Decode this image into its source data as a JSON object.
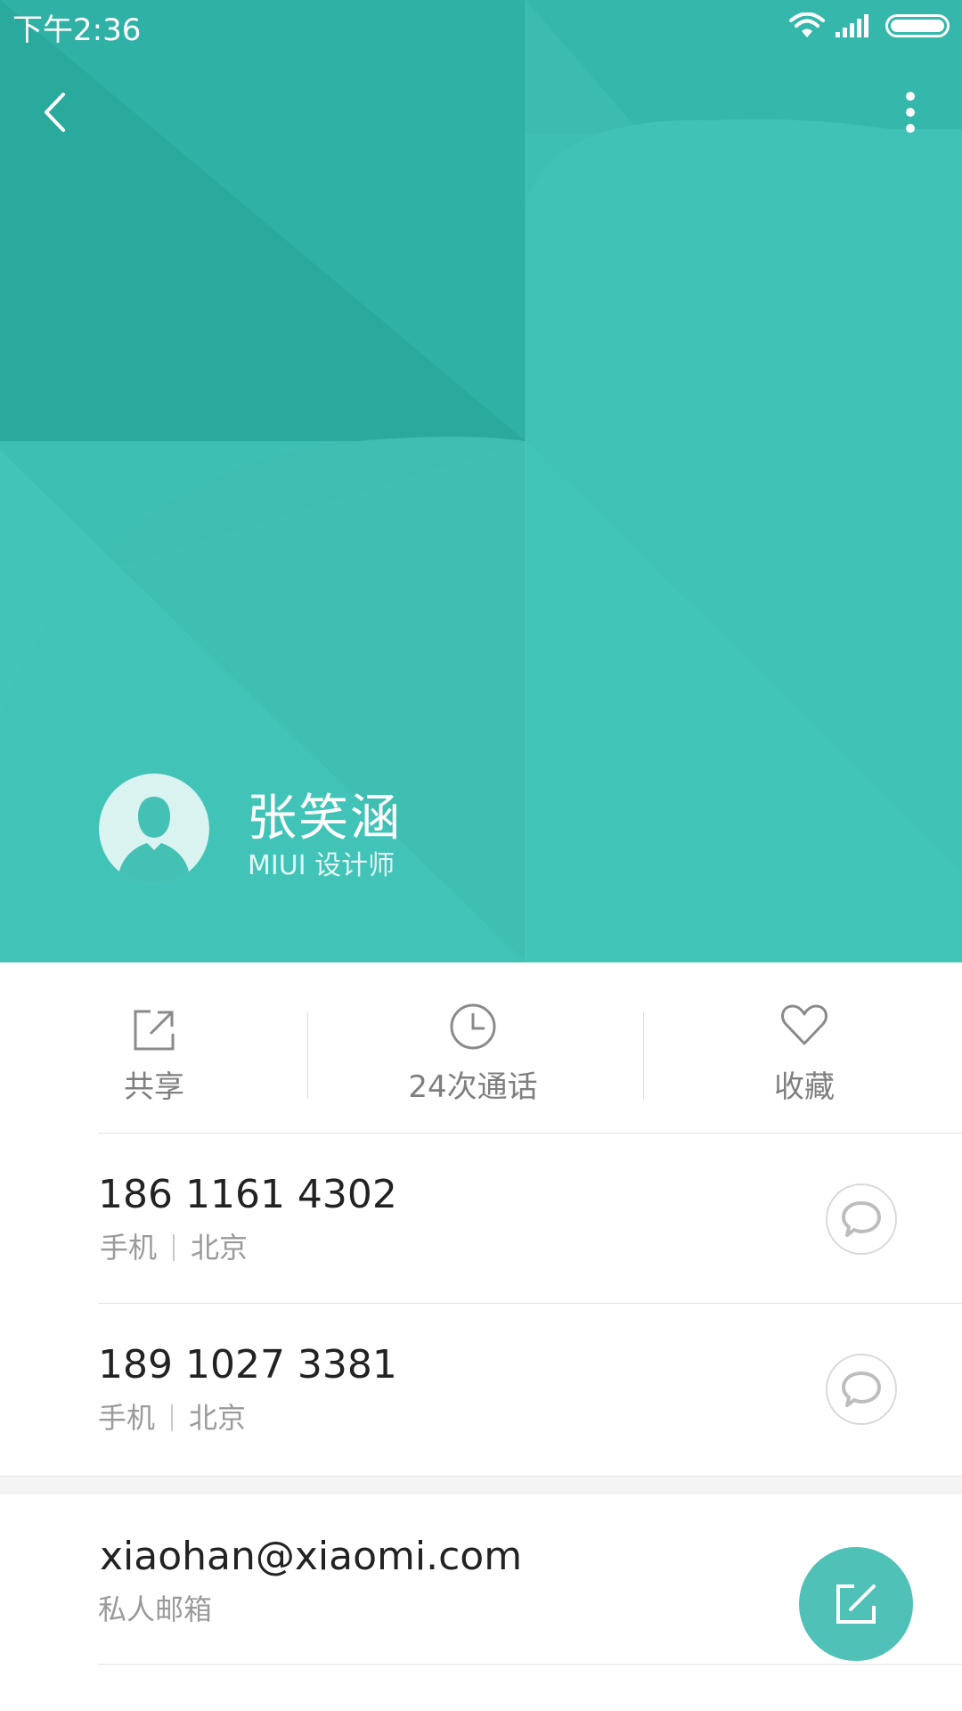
{
  "status_bar": {
    "time": "下午2:36",
    "icons": [
      "wifi-icon",
      "signal-icon",
      "battery-icon"
    ]
  },
  "nav": {
    "back_icon": "chevron-left-icon",
    "more_icon": "more-vertical-icon"
  },
  "contact": {
    "name": "张笑涵",
    "title": "MIUI 设计师",
    "avatar_icon": "person-silhouette-icon"
  },
  "actions": [
    {
      "label": "共享",
      "icon": "share-icon"
    },
    {
      "label": "24次通话",
      "icon": "clock-icon"
    },
    {
      "label": "收藏",
      "icon": "heart-icon"
    }
  ],
  "phones": [
    {
      "number": "186 1161 4302",
      "type": "手机",
      "location": "北京",
      "action_icon": "message-bubble-icon"
    },
    {
      "number": "189 1027 3381",
      "type": "手机",
      "location": "北京",
      "action_icon": "message-bubble-icon"
    }
  ],
  "email": {
    "address": "xiaohan@xiaomi.com",
    "label": "私人邮箱"
  },
  "fab": {
    "icon": "edit-icon"
  },
  "colors": {
    "header_teal": "#3fbfb3",
    "header_teal_dark": "#2aa99e",
    "fab": "#4fc1b6",
    "text_primary": "#222222",
    "text_secondary": "#9a9a9a"
  }
}
